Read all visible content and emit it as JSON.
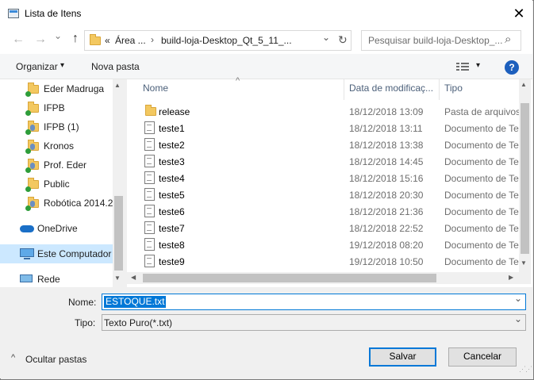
{
  "window": {
    "title": "Lista de Itens",
    "close_glyph": "✕"
  },
  "nav": {
    "back_glyph": "←",
    "forward_glyph": "→",
    "recent_glyph": "⌄",
    "up_glyph": "↑",
    "address": {
      "prefix": "«",
      "segments": [
        "Área ...",
        "build-loja-Desktop_Qt_5_11_..."
      ],
      "separator": "›",
      "chevron": "⌄",
      "refresh_glyph": "↻"
    },
    "search_placeholder": "Pesquisar build-loja-Desktop_...",
    "search_icon_glyph": "⌕"
  },
  "toolbar": {
    "organize_label": "Organizar",
    "organize_arrow": "▾",
    "new_folder_label": "Nova pasta",
    "view_arrow": "▾",
    "help_glyph": "?"
  },
  "sidebar": {
    "items": [
      {
        "label": "Eder Madruga",
        "icon": "folder-sync-icon"
      },
      {
        "label": "IFPB",
        "icon": "folder-sync-icon"
      },
      {
        "label": "IFPB (1)",
        "icon": "shared-folder-icon"
      },
      {
        "label": "Kronos",
        "icon": "shared-folder-icon"
      },
      {
        "label": "Prof. Eder",
        "icon": "shared-folder-icon"
      },
      {
        "label": "Public",
        "icon": "folder-sync-icon"
      },
      {
        "label": "Robótica 2014.2",
        "icon": "shared-folder-icon"
      },
      {
        "label": "OneDrive",
        "icon": "onedrive-icon"
      },
      {
        "label": "Este Computador",
        "icon": "computer-icon"
      },
      {
        "label": "Rede",
        "icon": "network-icon"
      }
    ],
    "scroll_up": "▲",
    "scroll_down": "▼"
  },
  "files": {
    "columns": {
      "name": "Nome",
      "date": "Data de modificaç...",
      "type": "Tipo"
    },
    "sort_glyph": "^",
    "rows": [
      {
        "name": "release",
        "date": "18/12/2018 13:09",
        "type": "Pasta de arquivos",
        "icon": "folder-icon"
      },
      {
        "name": "teste1",
        "date": "18/12/2018 13:11",
        "type": "Documento de Texto",
        "icon": "text-document-icon"
      },
      {
        "name": "teste2",
        "date": "18/12/2018 13:38",
        "type": "Documento de Texto",
        "icon": "text-document-icon"
      },
      {
        "name": "teste3",
        "date": "18/12/2018 14:45",
        "type": "Documento de Texto",
        "icon": "text-document-icon"
      },
      {
        "name": "teste4",
        "date": "18/12/2018 15:16",
        "type": "Documento de Texto",
        "icon": "text-document-icon"
      },
      {
        "name": "teste5",
        "date": "18/12/2018 20:30",
        "type": "Documento de Texto",
        "icon": "text-document-icon"
      },
      {
        "name": "teste6",
        "date": "18/12/2018 21:36",
        "type": "Documento de Texto",
        "icon": "text-document-icon"
      },
      {
        "name": "teste7",
        "date": "18/12/2018 22:52",
        "type": "Documento de Texto",
        "icon": "text-document-icon"
      },
      {
        "name": "teste8",
        "date": "19/12/2018 08:20",
        "type": "Documento de Texto",
        "icon": "text-document-icon"
      },
      {
        "name": "teste9",
        "date": "19/12/2018 10:50",
        "type": "Documento de Texto",
        "icon": "text-document-icon"
      }
    ],
    "scroll_left": "◀",
    "scroll_right": "▶",
    "scroll_up": "▲",
    "scroll_down": "▼"
  },
  "form": {
    "name_label": "Nome:",
    "name_value": "ESTOQUE.txt",
    "type_label": "Tipo:",
    "type_value": "Texto Puro(*.txt)",
    "dropdown_arrow": "⌄"
  },
  "footer": {
    "hide_folders_glyph": "^",
    "hide_folders_label": "Ocultar pastas",
    "save_label": "Salvar",
    "cancel_label": "Cancelar"
  },
  "colors": {
    "accent": "#0078d7",
    "selection": "#cce8ff",
    "folder": "#f3c860"
  }
}
